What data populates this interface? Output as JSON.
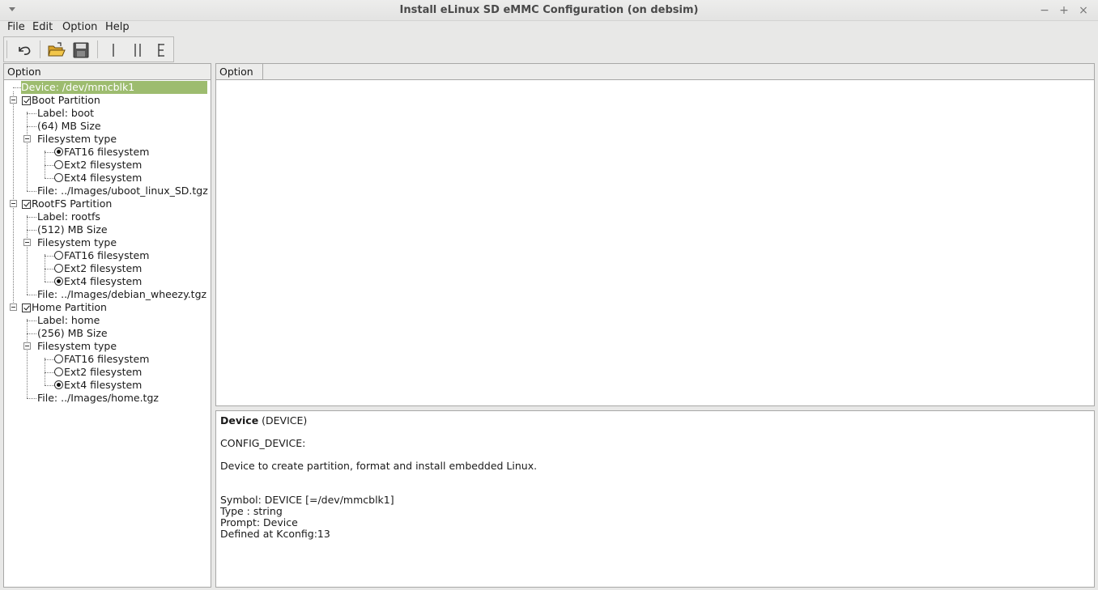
{
  "window": {
    "title": "Install eLinux SD eMMC Configuration (on debsim)",
    "controls": {
      "minimize": "−",
      "maximize": "+",
      "close": "×"
    }
  },
  "menu": {
    "file": "File",
    "edit": "Edit",
    "option": "Option",
    "help": "Help"
  },
  "toolbar": {
    "buttons": [
      "undo-icon",
      "open-folder-icon",
      "save-icon",
      "single-view-icon",
      "split-view-icon",
      "full-view-icon"
    ]
  },
  "left_pane": {
    "column_header": "Option"
  },
  "tree": {
    "device": "Device: /dev/mmcblk1",
    "boot": {
      "label": "Boot Partition",
      "checked": true,
      "label_item": "Label: boot",
      "size_item": "(64) MB Size",
      "fs_type": "Filesystem type",
      "fs_options": [
        "FAT16 filesystem",
        "Ext2 filesystem",
        "Ext4 filesystem"
      ],
      "fs_selected": 0,
      "file_item": "File: ../Images/uboot_linux_SD.tgz"
    },
    "rootfs": {
      "label": "RootFS Partition",
      "checked": true,
      "label_item": "Label: rootfs",
      "size_item": "(512) MB Size",
      "fs_type": "Filesystem type",
      "fs_options": [
        "FAT16 filesystem",
        "Ext2 filesystem",
        "Ext4 filesystem"
      ],
      "fs_selected": 2,
      "file_item": "File: ../Images/debian_wheezy.tgz"
    },
    "home": {
      "label": "Home Partition",
      "checked": true,
      "label_item": "Label: home",
      "size_item": "(256) MB Size",
      "fs_type": "Filesystem type",
      "fs_options": [
        "FAT16 filesystem",
        "Ext2 filesystem",
        "Ext4 filesystem"
      ],
      "fs_selected": 2,
      "file_item": "File: ../Images/home.tgz"
    }
  },
  "right_top": {
    "column_header": "Option"
  },
  "help": {
    "title_bold": "Device",
    "title_rest": " (DEVICE)",
    "config_name": "CONFIG_DEVICE:",
    "description": "Device to create partition, format and install embedded Linux.",
    "symbol": "Symbol: DEVICE [=/dev/mmcblk1]",
    "type": "Type : string",
    "prompt": "Prompt: Device",
    "defined": "Defined at Kconfig:13"
  }
}
